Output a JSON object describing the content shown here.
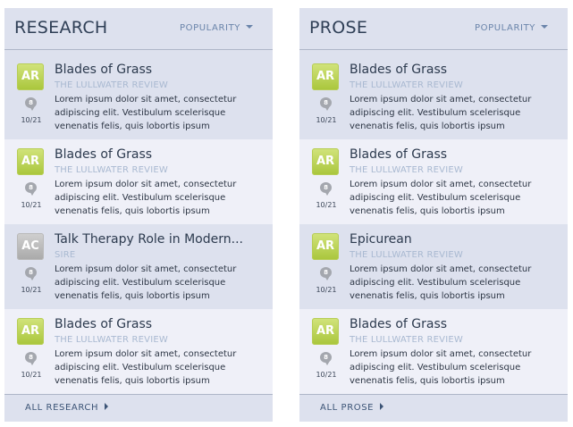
{
  "colors": {
    "panel_bg": "#dde1ee",
    "alt_row_bg": "#eff0f8",
    "badge_green": "#b3cc45",
    "badge_grey": "#b4b4b4",
    "link_blue": "#6a84aa"
  },
  "panels": [
    {
      "title": "RESEARCH",
      "sort_label": "POPULARITY",
      "footer_link": "ALL RESEARCH",
      "items": [
        {
          "initials": "AR",
          "comments": "8",
          "date": "10/21",
          "title": "Blades of Grass",
          "source": "THE LULLWATER REVIEW",
          "excerpt": "Lorem ipsum dolor sit amet, consectetur adipiscing elit. Vestibulum scelerisque venenatis felis, quis lobortis ipsum"
        },
        {
          "initials": "AR",
          "comments": "8",
          "date": "10/21",
          "title": "Blades of Grass",
          "source": "THE LULLWATER REVIEW",
          "excerpt": "Lorem ipsum dolor sit amet, consectetur adipiscing elit. Vestibulum scelerisque venenatis felis, quis lobortis ipsum"
        },
        {
          "initials": "AC",
          "comments": "8",
          "date": "10/21",
          "title": "Talk Therapy Role in Modern...",
          "source": "SIRE",
          "excerpt": "Lorem ipsum dolor sit amet, consectetur adipiscing elit. Vestibulum scelerisque venenatis felis, quis lobortis ipsum"
        },
        {
          "initials": "AR",
          "comments": "8",
          "date": "10/21",
          "title": "Blades of Grass",
          "source": "THE LULLWATER REVIEW",
          "excerpt": "Lorem ipsum dolor sit amet, consectetur adipiscing elit. Vestibulum scelerisque venenatis felis, quis lobortis ipsum"
        }
      ]
    },
    {
      "title": "PROSE",
      "sort_label": "POPULARITY",
      "footer_link": "ALL PROSE",
      "items": [
        {
          "initials": "AR",
          "comments": "8",
          "date": "10/21",
          "title": "Blades of Grass",
          "source": "THE LULLWATER REVIEW",
          "excerpt": "Lorem ipsum dolor sit amet, consectetur adipiscing elit. Vestibulum scelerisque venenatis felis, quis lobortis ipsum"
        },
        {
          "initials": "AR",
          "comments": "8",
          "date": "10/21",
          "title": "Blades of Grass",
          "source": "THE LULLWATER REVIEW",
          "excerpt": "Lorem ipsum dolor sit amet, consectetur adipiscing elit. Vestibulum scelerisque venenatis felis, quis lobortis ipsum"
        },
        {
          "initials": "AR",
          "comments": "8",
          "date": "10/21",
          "title": "Epicurean",
          "source": "THE LULLWATER REVIEW",
          "excerpt": "Lorem ipsum dolor sit amet, consectetur adipiscing elit. Vestibulum scelerisque venenatis felis, quis lobortis ipsum"
        },
        {
          "initials": "AR",
          "comments": "8",
          "date": "10/21",
          "title": "Blades of Grass",
          "source": "THE LULLWATER REVIEW",
          "excerpt": "Lorem ipsum dolor sit amet, consectetur adipiscing elit. Vestibulum scelerisque venenatis felis, quis lobortis ipsum"
        }
      ]
    }
  ]
}
